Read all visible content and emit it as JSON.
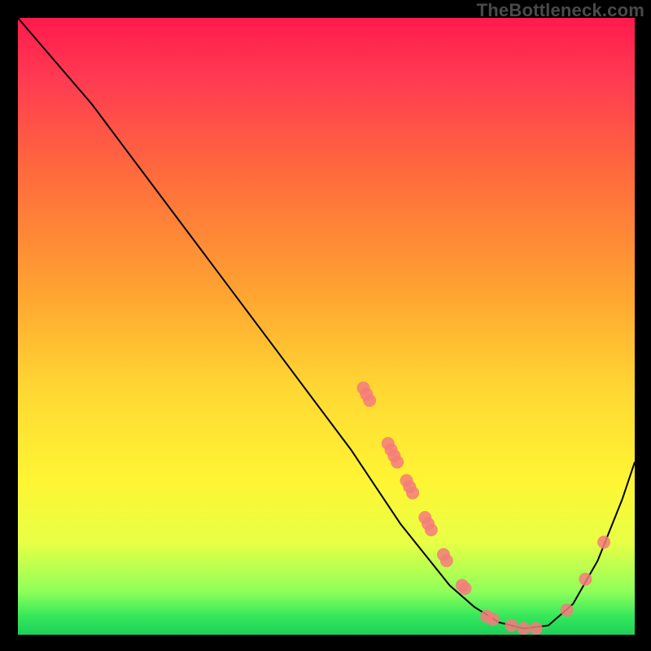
{
  "attribution": "TheBottleneck.com",
  "colors": {
    "curve": "#000000",
    "dots": "#f47b7b",
    "bg_top": "#ff1a4d",
    "bg_bottom": "#1ecf58"
  },
  "chart_data": {
    "type": "line",
    "title": "",
    "xlabel": "",
    "ylabel": "",
    "xlim": [
      0,
      100
    ],
    "ylim": [
      0,
      100
    ],
    "grid": false,
    "legend": false,
    "series": [
      {
        "name": "bottleneck-curve",
        "x": [
          0,
          6,
          12,
          18,
          24,
          30,
          36,
          42,
          48,
          54,
          58,
          62,
          66,
          70,
          74,
          78,
          82,
          86,
          90,
          94,
          98,
          100
        ],
        "y": [
          100,
          93,
          86,
          78,
          70,
          62,
          54,
          46,
          38,
          30,
          24,
          18,
          13,
          8,
          4.5,
          2,
          1,
          1.5,
          5,
          12,
          22,
          28
        ]
      }
    ],
    "points": [
      {
        "name": "cluster-a",
        "x": 56,
        "y": 40
      },
      {
        "name": "cluster-a",
        "x": 56.5,
        "y": 39
      },
      {
        "name": "cluster-a",
        "x": 57,
        "y": 38
      },
      {
        "name": "cluster-b",
        "x": 60,
        "y": 31
      },
      {
        "name": "cluster-b",
        "x": 60.5,
        "y": 30
      },
      {
        "name": "cluster-b",
        "x": 61,
        "y": 29
      },
      {
        "name": "cluster-b",
        "x": 61.5,
        "y": 28
      },
      {
        "name": "cluster-c",
        "x": 63,
        "y": 25
      },
      {
        "name": "cluster-c",
        "x": 63.5,
        "y": 24
      },
      {
        "name": "cluster-c",
        "x": 64,
        "y": 23
      },
      {
        "name": "cluster-d",
        "x": 66,
        "y": 19
      },
      {
        "name": "cluster-d",
        "x": 66.5,
        "y": 18
      },
      {
        "name": "cluster-d",
        "x": 67,
        "y": 17
      },
      {
        "name": "cluster-e",
        "x": 69,
        "y": 13
      },
      {
        "name": "cluster-e",
        "x": 69.5,
        "y": 12
      },
      {
        "name": "cluster-f",
        "x": 72,
        "y": 8
      },
      {
        "name": "cluster-f",
        "x": 72.5,
        "y": 7.5
      },
      {
        "name": "valley",
        "x": 76,
        "y": 3
      },
      {
        "name": "valley",
        "x": 77,
        "y": 2.5
      },
      {
        "name": "valley",
        "x": 80,
        "y": 1.5
      },
      {
        "name": "valley",
        "x": 82,
        "y": 1
      },
      {
        "name": "valley",
        "x": 84,
        "y": 1
      },
      {
        "name": "rise",
        "x": 89,
        "y": 4
      },
      {
        "name": "rise",
        "x": 92,
        "y": 9
      },
      {
        "name": "rise",
        "x": 95,
        "y": 15
      }
    ]
  }
}
